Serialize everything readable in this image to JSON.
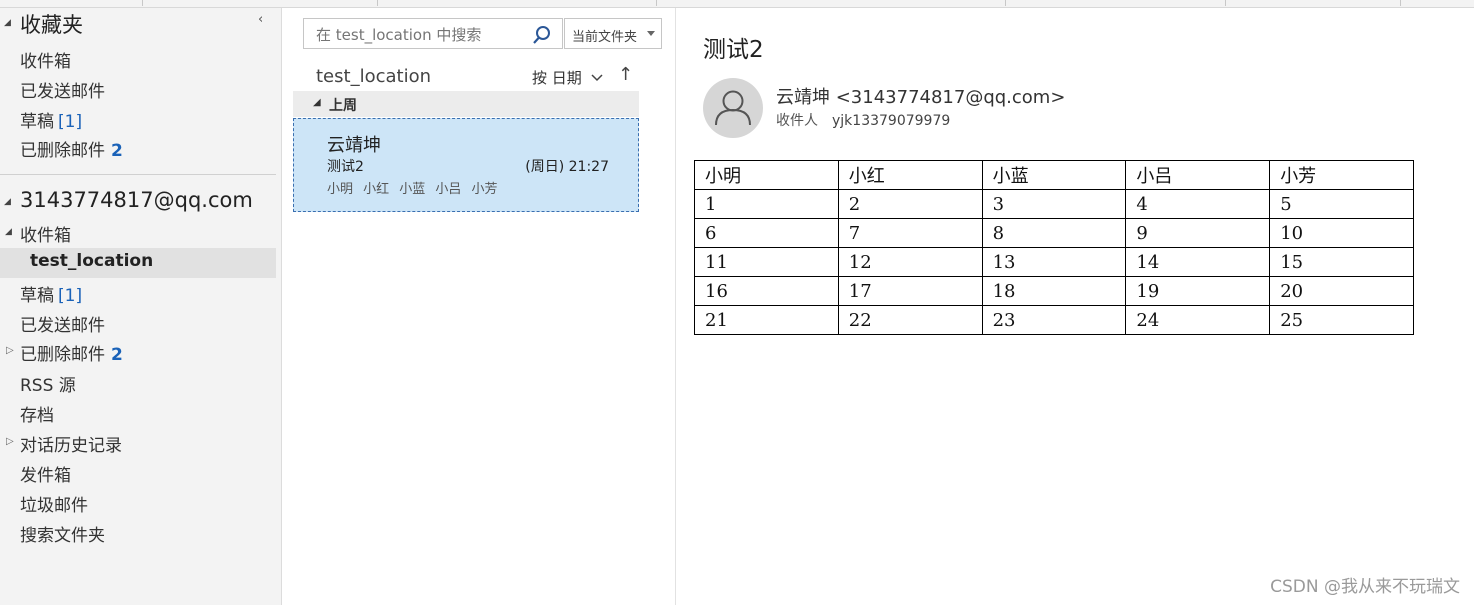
{
  "folders": {
    "favorites_title": "收藏夹",
    "favorites": [
      {
        "label": "收件箱",
        "count": ""
      },
      {
        "label": "已发送邮件",
        "count": ""
      },
      {
        "label": "草稿",
        "count": "[1]"
      },
      {
        "label": "已删除邮件",
        "count": "2"
      }
    ],
    "account": "3143774817@qq.com",
    "inbox": "收件箱",
    "selected_folder": "test_location",
    "items": [
      {
        "label": "草稿",
        "count": "[1]"
      },
      {
        "label": "已发送邮件",
        "count": ""
      },
      {
        "label": "已删除邮件",
        "count": "2"
      },
      {
        "label": "RSS 源",
        "count": ""
      },
      {
        "label": "存档",
        "count": ""
      },
      {
        "label": "对话历史记录",
        "count": ""
      },
      {
        "label": "发件箱",
        "count": ""
      },
      {
        "label": "垃圾邮件",
        "count": ""
      },
      {
        "label": "搜索文件夹",
        "count": ""
      }
    ]
  },
  "list": {
    "search_placeholder": "在 test_location 中搜索",
    "scope": "当前文件夹",
    "folder_name": "test_location",
    "sort": "按 日期",
    "sort_arrow": "↑",
    "group": "上周",
    "messages": [
      {
        "from": "云靖坤",
        "subject": "测试2",
        "date": "(周日) 21:27",
        "preview": "小明 小红 小蓝 小吕 小芳"
      }
    ]
  },
  "reading": {
    "subject": "测试2",
    "sender": "云靖坤 <3143774817@qq.com>",
    "to_label": "收件人",
    "to_value": "yjk13379079979",
    "table": [
      [
        "小明",
        "小红",
        "小蓝",
        "小吕",
        "小芳"
      ],
      [
        "1",
        "2",
        "3",
        "4",
        "5"
      ],
      [
        "6",
        "7",
        "8",
        "9",
        "10"
      ],
      [
        "11",
        "12",
        "13",
        "14",
        "15"
      ],
      [
        "16",
        "17",
        "18",
        "19",
        "20"
      ],
      [
        "21",
        "22",
        "23",
        "24",
        "25"
      ]
    ]
  },
  "watermark": "CSDN @我从来不玩瑞文",
  "colors": {
    "accent": "#1a62b8",
    "selection": "#cde5f7"
  }
}
